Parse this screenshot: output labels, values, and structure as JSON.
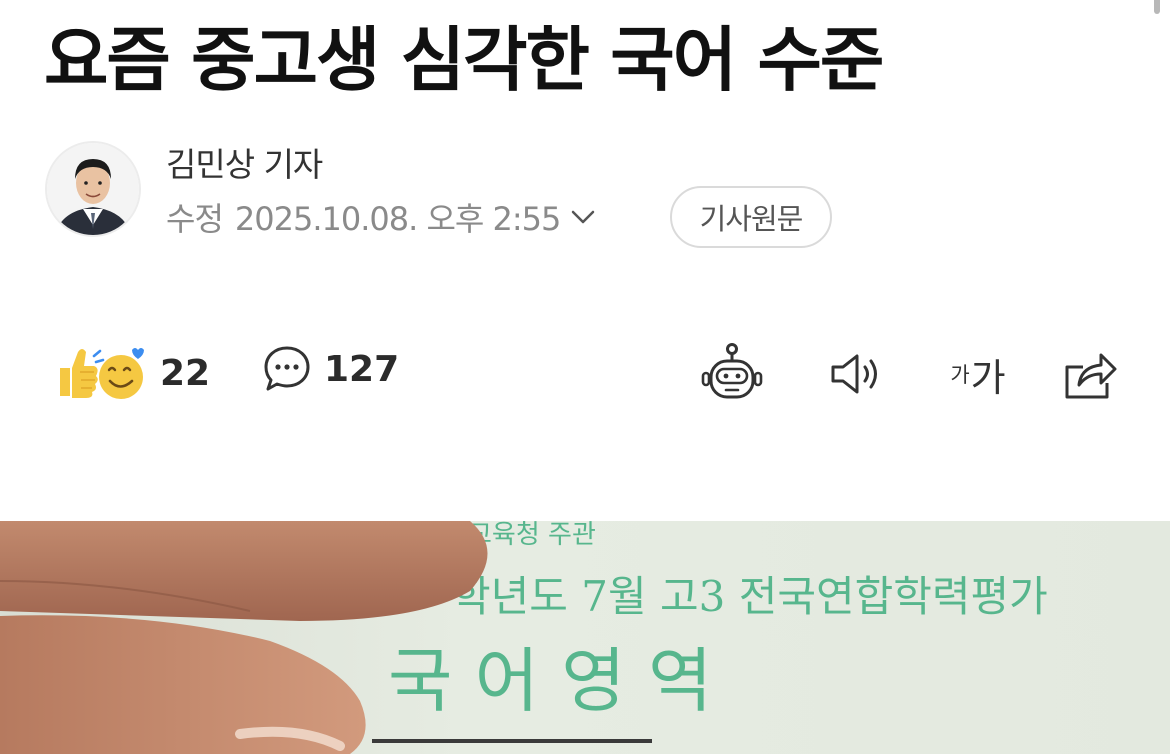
{
  "article": {
    "headline": "요즘 중고생 심각한 국어 수준"
  },
  "byline": {
    "reporter": "김민상 기자",
    "date_prefix": "수정",
    "date_value": "2025.10.08. 오후 2:55",
    "original_button": "기사원문"
  },
  "toolbar": {
    "reaction_count": "22",
    "comment_count": "127",
    "font_small": "가",
    "font_large": "가",
    "icons": [
      "thumbs-up-emoji",
      "smile-emoji",
      "comment-bubble-icon",
      "robot-icon",
      "speaker-icon",
      "font-size-icon",
      "share-icon"
    ]
  },
  "photo": {
    "line1": "교육청 주관",
    "line2": "학년도 7월 고3 전국연합학력평가",
    "line3": "국 어 영 역"
  },
  "colors": {
    "title": "#111111",
    "meta": "#8a8a8a",
    "exam_green": "#57b68d",
    "paper": "#e7ede3"
  }
}
